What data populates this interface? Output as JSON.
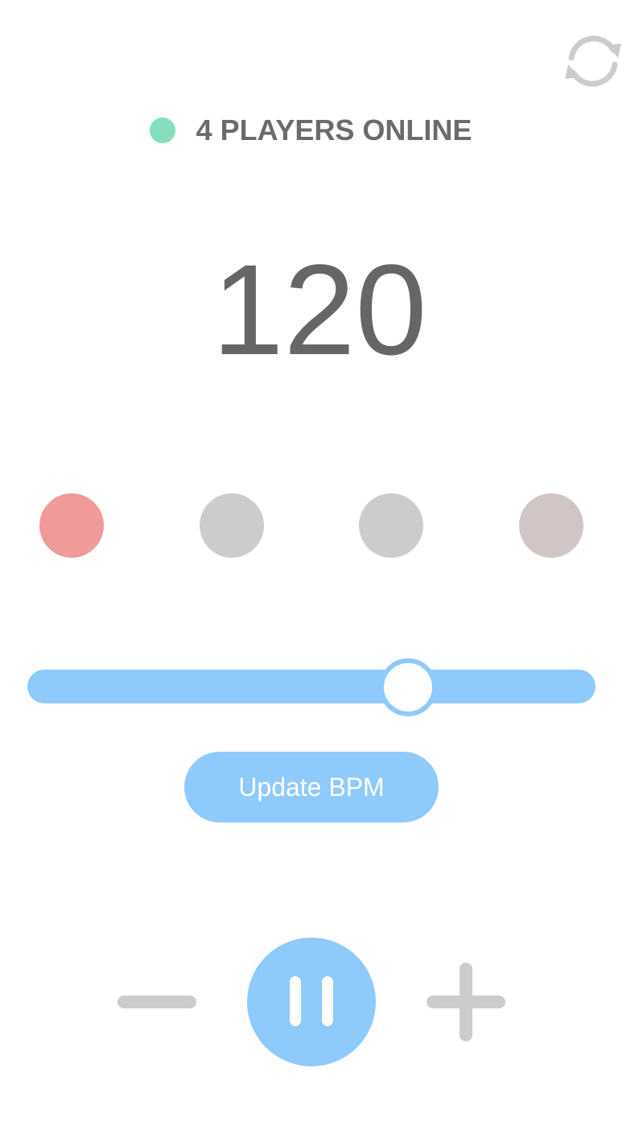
{
  "colors": {
    "accent": "#8ecafb",
    "text": "#666666",
    "icon": "#cccccc",
    "online": "#86dfbc",
    "beat_active": "#f09a99",
    "beat_idle": "#cccccc",
    "beat_last": "#d2c5c5"
  },
  "header": {
    "sync_icon": "refresh-icon"
  },
  "status": {
    "text": "4 PLAYERS ONLINE",
    "players_online": 4
  },
  "tempo": {
    "bpm": "120"
  },
  "beats": [
    {
      "index": 1,
      "state": "active"
    },
    {
      "index": 2,
      "state": "idle"
    },
    {
      "index": 3,
      "state": "idle"
    },
    {
      "index": 4,
      "state": "idle-tinted"
    }
  ],
  "slider": {
    "fraction": 0.67
  },
  "update_button": {
    "label": "Update BPM"
  },
  "controls": {
    "minus_icon": "minus-icon",
    "pause_icon": "pause-icon",
    "plus_icon": "plus-icon"
  }
}
